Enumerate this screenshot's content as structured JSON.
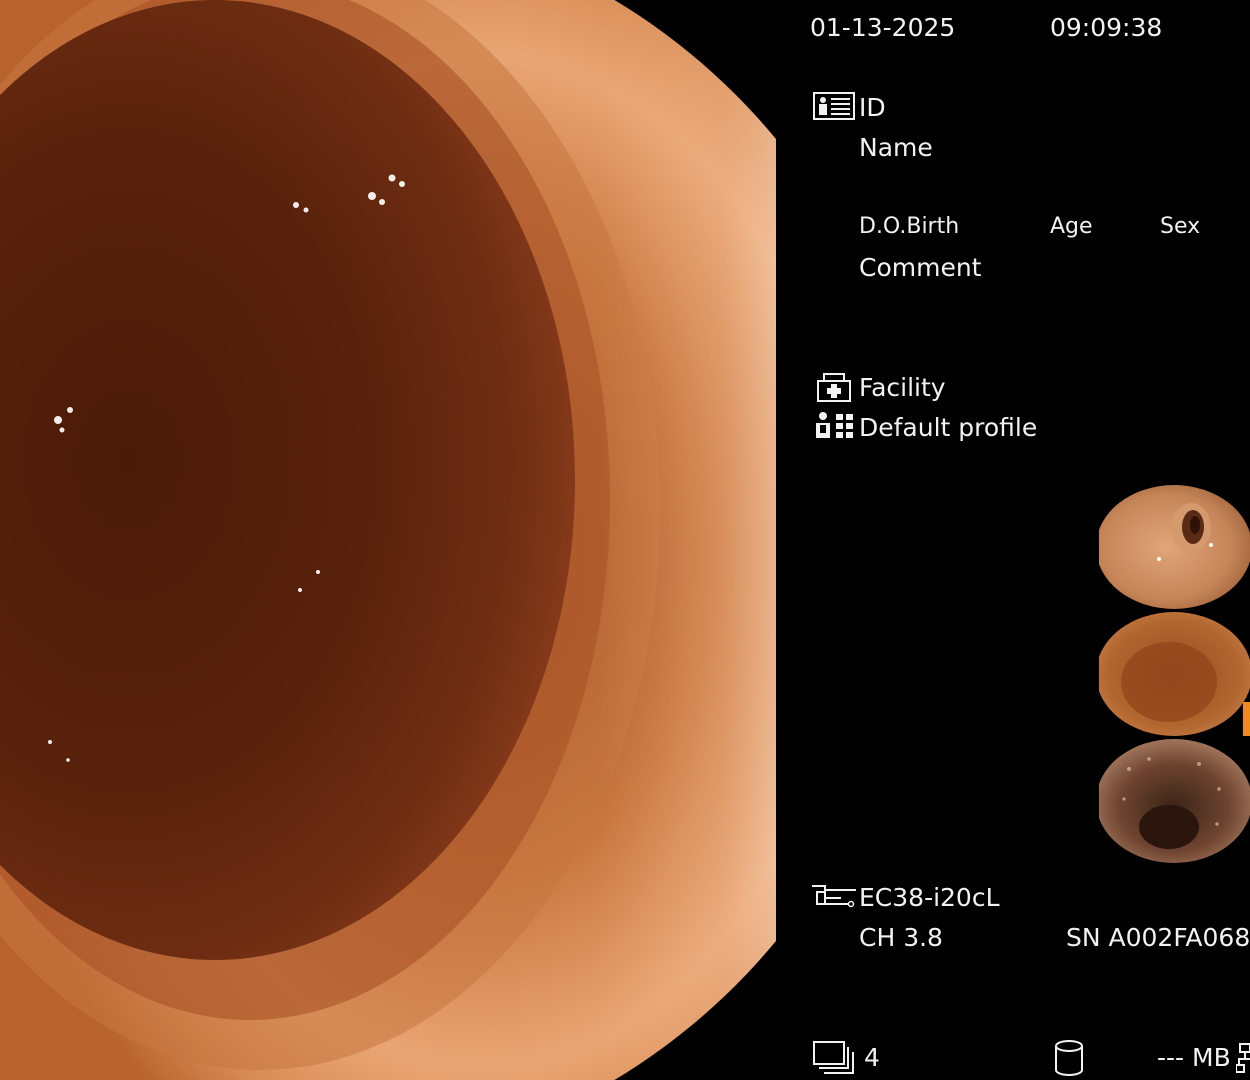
{
  "header": {
    "date": "01-13-2025",
    "time": "09:09:38"
  },
  "patient": {
    "id_label": "ID",
    "name_label": "Name",
    "dob_label": "D.O.Birth",
    "age_label": "Age",
    "sex_label": "Sex",
    "comment_label": "Comment"
  },
  "facility": {
    "facility_label": "Facility",
    "profile_label": "Default profile"
  },
  "thumbnails": {
    "count_shown": 3,
    "colors": [
      "#c98a5a",
      "#a8582a",
      "#6e4430"
    ]
  },
  "scope": {
    "model": "EC38-i20cL",
    "channel": "CH 3.8",
    "serial": "SN A002FA068"
  },
  "footer": {
    "image_count": "4",
    "storage": "--- MB"
  },
  "colors": {
    "background": "#000000",
    "text": "#f2f2f2",
    "lumen_dark": "#3a1406",
    "mucosa_light": "#e7a06e"
  },
  "icons": {
    "patient": "patient-card-icon",
    "facility": "facility-icon",
    "profile": "user-profile-icon",
    "scope": "endoscope-icon",
    "images": "image-stack-icon",
    "storage": "database-icon",
    "network": "network-icon"
  }
}
